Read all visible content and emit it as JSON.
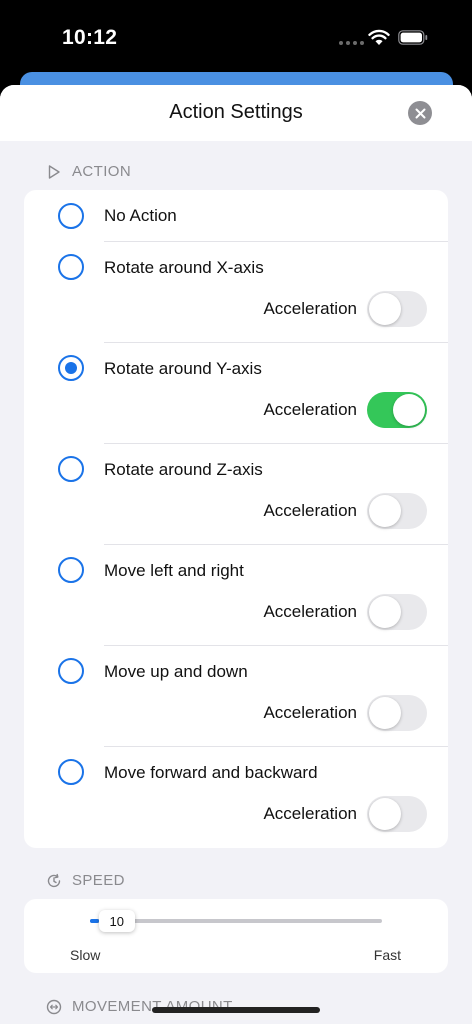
{
  "status_bar": {
    "time": "10:12"
  },
  "sheet": {
    "title": "Action Settings"
  },
  "sections": {
    "action": {
      "label": "ACTION",
      "icon": "play-outline-icon"
    },
    "speed": {
      "label": "SPEED",
      "icon": "timer-refresh-icon"
    },
    "movement": {
      "label": "MOVEMENT AMOUNT",
      "icon": "horizontal-arrows-icon"
    }
  },
  "actions": [
    {
      "label": "No Action",
      "selected": false
    },
    {
      "label": "Rotate around X-axis",
      "selected": false,
      "accel_label": "Acceleration",
      "accel_on": false
    },
    {
      "label": "Rotate around Y-axis",
      "selected": true,
      "accel_label": "Acceleration",
      "accel_on": true
    },
    {
      "label": "Rotate around Z-axis",
      "selected": false,
      "accel_label": "Acceleration",
      "accel_on": false
    },
    {
      "label": "Move left and right",
      "selected": false,
      "accel_label": "Acceleration",
      "accel_on": false
    },
    {
      "label": "Move up and down",
      "selected": false,
      "accel_label": "Acceleration",
      "accel_on": false
    },
    {
      "label": "Move forward and backward",
      "selected": false,
      "accel_label": "Acceleration",
      "accel_on": false
    }
  ],
  "speed": {
    "value": "10",
    "min_label": "Slow",
    "max_label": "Fast",
    "fraction": 0.03
  },
  "colors": {
    "accent": "#1a73e8",
    "toggle_on": "#34c759",
    "toggle_off": "#e9e9ec",
    "background": "#f2f2f7"
  }
}
